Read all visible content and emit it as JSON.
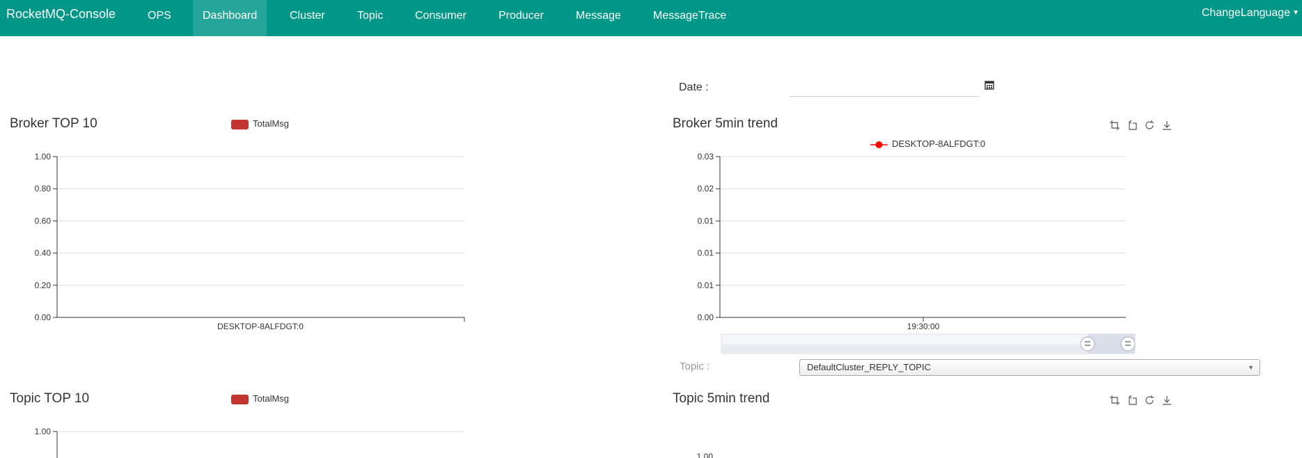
{
  "navbar": {
    "brand": "RocketMQ-Console",
    "items": [
      {
        "label": "OPS"
      },
      {
        "label": "Dashboard",
        "active": true
      },
      {
        "label": "Cluster"
      },
      {
        "label": "Topic"
      },
      {
        "label": "Consumer"
      },
      {
        "label": "Producer"
      },
      {
        "label": "Message"
      },
      {
        "label": "MessageTrace"
      }
    ],
    "language": "ChangeLanguage"
  },
  "date_filter": {
    "label": "Date :",
    "value": ""
  },
  "topic_filter": {
    "label": "Topic :",
    "selected": "DefaultCluster_REPLY_TOPIC"
  },
  "colors": {
    "navbar": "#009688",
    "active_nav": "#26a69a",
    "bar_series": "#c23531",
    "line_series": "#ff0000"
  },
  "chart_data": [
    {
      "type": "bar",
      "title": "Broker TOP 10",
      "legend": [
        "TotalMsg"
      ],
      "categories": [
        "DESKTOP-8ALFDGT:0"
      ],
      "series": [
        {
          "name": "TotalMsg",
          "values": [
            0
          ]
        }
      ],
      "yticks": [
        "0.00",
        "0.20",
        "0.40",
        "0.60",
        "0.80",
        "1.00"
      ],
      "ylim": [
        0,
        1
      ],
      "grid": true
    },
    {
      "type": "line",
      "title": "Broker 5min trend",
      "legend": [
        "DESKTOP-8ALFDGT:0"
      ],
      "x": [
        "19:30:00"
      ],
      "series": [
        {
          "name": "DESKTOP-8ALFDGT:0",
          "values": []
        }
      ],
      "yticks": [
        "0.00",
        "0.01",
        "0.01",
        "0.01",
        "0.02",
        "0.03"
      ],
      "toolbox": [
        "zoom-icon",
        "zoom-reset-icon",
        "restore-icon",
        "download-icon"
      ],
      "grid": true,
      "datazoom": true
    },
    {
      "type": "bar",
      "title": "Topic TOP 10",
      "legend": [
        "TotalMsg"
      ],
      "yticks": [
        "1.00"
      ],
      "grid": true
    },
    {
      "type": "line",
      "title": "Topic 5min trend",
      "yticks": [
        "1.00"
      ],
      "toolbox": [
        "zoom-icon",
        "zoom-reset-icon",
        "restore-icon",
        "download-icon"
      ]
    }
  ]
}
